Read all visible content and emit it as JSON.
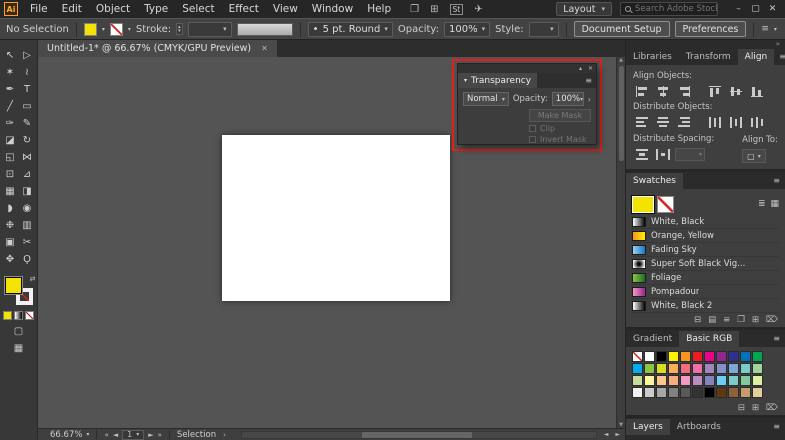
{
  "icons": {
    "chevron_down": "▾",
    "chevron_up": "▴",
    "chevron_right": "›",
    "close": "✕",
    "menu": "≡",
    "minimize": "–",
    "maximize": "▢",
    "dot": "•",
    "swap": "⇄",
    "double_chevron": "»",
    "first": "«",
    "prev": "◄",
    "next": "►",
    "last": "»",
    "scroll_up": "▲",
    "scroll_down": "▼",
    "scroll_left": "◄",
    "scroll_right": "►",
    "list_view": "≣",
    "grid_view": "▦",
    "collapse": "▴",
    "default_swatches": "◩",
    "stepper": "▴▾"
  },
  "menubar": {
    "logo": "Ai",
    "items": [
      "File",
      "Edit",
      "Object",
      "Type",
      "Select",
      "Effect",
      "View",
      "Window",
      "Help"
    ],
    "tool_icons": [
      {
        "name": "arrange-documents-icon",
        "glyph": "❐"
      },
      {
        "name": "app-grid-icon",
        "glyph": "⊞"
      },
      {
        "name": "stock-icon",
        "glyph": "St"
      },
      {
        "name": "share-icon",
        "glyph": "✈"
      }
    ],
    "layout_label": "Layout",
    "search_placeholder": "Search Adobe Stock"
  },
  "controlbar": {
    "no_selection": "No Selection",
    "stroke_label": "Stroke:",
    "stroke_value": "",
    "brush_label": "5 pt. Round",
    "opacity_label": "Opacity:",
    "opacity_value": "100%",
    "style_label": "Style:",
    "document_setup_label": "Document Setup",
    "preferences_label": "Preferences"
  },
  "document_tab": {
    "title": "Untitled-1* @ 66.67% (CMYK/GPU Preview)"
  },
  "toolbar": {
    "fill_color": "#f4e300",
    "tools": [
      {
        "name": "selection",
        "glyph": "↖"
      },
      {
        "name": "direct-selection",
        "glyph": "▷"
      },
      {
        "name": "magic-wand",
        "glyph": "✶"
      },
      {
        "name": "lasso",
        "glyph": "≀"
      },
      {
        "name": "pen",
        "glyph": "✒"
      },
      {
        "name": "type",
        "glyph": "T"
      },
      {
        "name": "line-segment",
        "glyph": "╱"
      },
      {
        "name": "rectangle",
        "glyph": "▭"
      },
      {
        "name": "paintbrush",
        "glyph": "✑"
      },
      {
        "name": "pencil",
        "glyph": "✎"
      },
      {
        "name": "eraser",
        "glyph": "◪"
      },
      {
        "name": "rotate",
        "glyph": "↻"
      },
      {
        "name": "scale",
        "glyph": "◱"
      },
      {
        "name": "width",
        "glyph": "⋈"
      },
      {
        "name": "shape-builder",
        "glyph": "⊡"
      },
      {
        "name": "perspective-grid",
        "glyph": "⊿"
      },
      {
        "name": "mesh",
        "glyph": "▦"
      },
      {
        "name": "gradient",
        "glyph": "◨"
      },
      {
        "name": "eyedropper",
        "glyph": "◗"
      },
      {
        "name": "blend",
        "glyph": "◉"
      },
      {
        "name": "symbol-sprayer",
        "glyph": "❉"
      },
      {
        "name": "column-graph",
        "glyph": "▥"
      },
      {
        "name": "artboard",
        "glyph": "▣"
      },
      {
        "name": "slice",
        "glyph": "✂"
      },
      {
        "name": "hand",
        "glyph": "✥"
      },
      {
        "name": "zoom",
        "glyph": "Ϙ"
      }
    ]
  },
  "transparency_panel": {
    "title": "Transparency",
    "blend_mode": "Normal",
    "opacity_label": "Opacity:",
    "opacity_value": "100%",
    "make_mask_label": "Make Mask",
    "clip_label": "Clip",
    "invert_mask_label": "Invert Mask",
    "highlight_color": "#e3201c"
  },
  "right_panel": {
    "tabs": [
      {
        "label": "Libraries",
        "active": false
      },
      {
        "label": "Transform",
        "active": false
      },
      {
        "label": "Align",
        "active": true
      }
    ],
    "align": {
      "align_objects_label": "Align Objects:",
      "align_icons": [
        "align-left",
        "align-hcenter",
        "align-right",
        "align-top",
        "align-vcenter",
        "align-bottom"
      ],
      "distribute_objects_label": "Distribute Objects:",
      "distribute_icons": [
        "distribute-top",
        "distribute-vcenter",
        "distribute-bottom",
        "distribute-left",
        "distribute-hcenter",
        "distribute-right"
      ],
      "distribute_spacing_label": "Distribute Spacing:",
      "spacing_icons": [
        "spacing-vertical",
        "spacing-horizontal"
      ],
      "align_to_label": "Align To:"
    },
    "swatches": {
      "title": "Swatches",
      "selected_color": "#f4e300",
      "items": [
        {
          "label": "White, Black",
          "type": "linear",
          "colors": [
            "#ffffff",
            "#000000"
          ]
        },
        {
          "label": "Orange, Yellow",
          "type": "linear",
          "colors": [
            "#f7941d",
            "#fff200"
          ]
        },
        {
          "label": "Fading Sky",
          "type": "linear",
          "colors": [
            "#9ad2f2",
            "#1b75bc"
          ]
        },
        {
          "label": "Super Soft Black Vig...",
          "type": "radial",
          "colors": [
            "#000000",
            "#ffffff"
          ]
        },
        {
          "label": "Foliage",
          "type": "linear",
          "colors": [
            "#8dc63f",
            "#1e6b2e"
          ]
        },
        {
          "label": "Pompadour",
          "type": "linear",
          "colors": [
            "#f29ac0",
            "#93278f"
          ]
        },
        {
          "label": "White, Black 2",
          "type": "linear",
          "colors": [
            "#ffffff",
            "#000000"
          ]
        }
      ],
      "footer_icons": [
        {
          "name": "swatch-libraries-icon",
          "glyph": "⊟"
        },
        {
          "name": "swatch-kinds-icon",
          "glyph": "▤"
        },
        {
          "name": "swatch-options-icon",
          "glyph": "≡"
        },
        {
          "name": "new-color-group-icon",
          "glyph": "❐"
        },
        {
          "name": "new-swatch-icon",
          "glyph": "⊞"
        },
        {
          "name": "delete-swatch-icon",
          "glyph": "⌦"
        }
      ]
    },
    "gradient_tabs": [
      {
        "label": "Gradient",
        "active": false
      },
      {
        "label": "Basic RGB",
        "active": true
      }
    ],
    "palette": {
      "grid": [
        [
          "none",
          "#ffffff",
          "#000000",
          "#fff200",
          "#f7941d",
          "#ed1c24",
          "#ec008c",
          "#92278f",
          "#2e3192",
          "#0072bc",
          "#00a651"
        ],
        [
          "#00aeef",
          "#8dc63f",
          "#d7df23",
          "#fbaf5d",
          "#f26d7d",
          "#f06eaa",
          "#a186be",
          "#8393ca",
          "#7da7d9",
          "#7accc8",
          "#a3d39c"
        ],
        [
          "#c4df9b",
          "#fff799",
          "#fdc68a",
          "#f9ad81",
          "#f49ac2",
          "#bd8cbf",
          "#8882be",
          "#6dcff6",
          "#7bcdc8",
          "#82ca9d",
          "#ddf0a4"
        ],
        [
          "#f2f2f2",
          "#cccccc",
          "#a6a6a6",
          "#808080",
          "#595959",
          "#333333",
          "#000000",
          "#603913",
          "#8c6239",
          "#c69c6d",
          "#e6ce9c"
        ]
      ],
      "footer_icons": [
        {
          "name": "swatch-libraries-icon",
          "glyph": "⊟"
        },
        {
          "name": "new-swatch-icon",
          "glyph": "⊞"
        },
        {
          "name": "delete-swatch-icon",
          "glyph": "⌦"
        }
      ]
    },
    "bottom_tabs": [
      {
        "label": "Layers",
        "active": true
      },
      {
        "label": "Artboards",
        "active": false
      }
    ]
  },
  "statusbar": {
    "zoom": "66.67%",
    "artboard_number": "1",
    "status": "Selection"
  }
}
